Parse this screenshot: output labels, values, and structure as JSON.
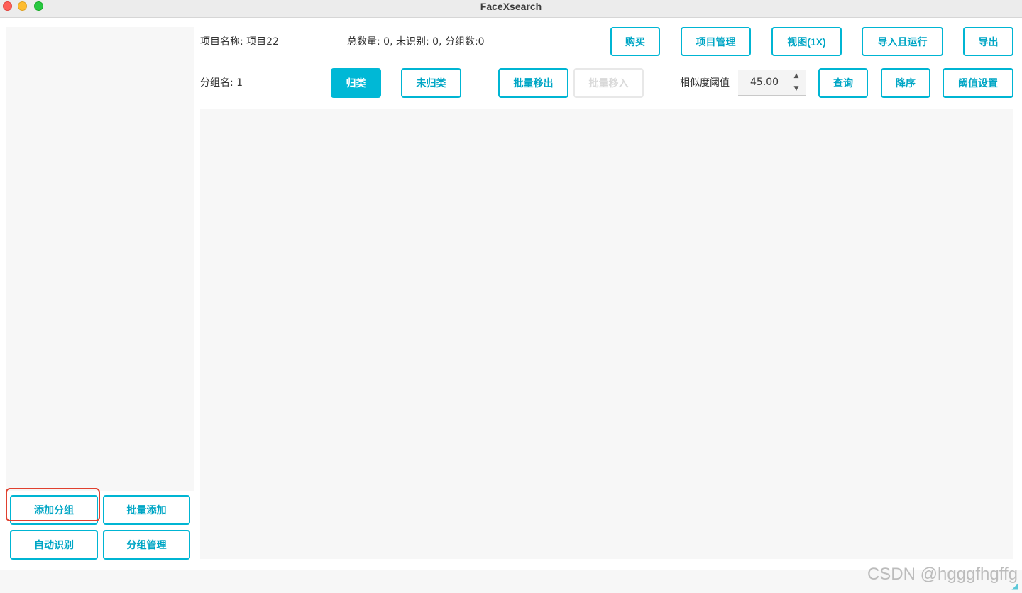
{
  "window": {
    "title": "FaceXsearch"
  },
  "header": {
    "project_label": "项目名称: 项目22",
    "stats_label": "总数量: 0, 未识别: 0, 分组数:0",
    "group_label": "分组名: 1",
    "threshold_label": "相似度阈值"
  },
  "toolbar": {
    "buy": "购买",
    "project_manage": "项目管理",
    "view": "视图(1X)",
    "import_run": "导入且运行",
    "export": "导出",
    "classified": "归类",
    "unclassified": "未归类",
    "batch_move_out": "批量移出",
    "batch_move_in": "批量移入",
    "query": "查询",
    "sort_desc": "降序",
    "threshold_settings": "阈值设置"
  },
  "threshold": {
    "value": "45.00",
    "up_icon": "▲",
    "down_icon": "▼"
  },
  "sidebar": {
    "add_group": "添加分组",
    "batch_add": "批量添加",
    "auto_recognize": "自动识别",
    "group_manage": "分组管理"
  },
  "watermark": "CSDN @hgggfhgffg",
  "colors": {
    "accent": "#00b5d3",
    "primary_fill": "#00b8d6",
    "highlight": "#e0402f",
    "panel_bg": "#f7f7f7"
  }
}
